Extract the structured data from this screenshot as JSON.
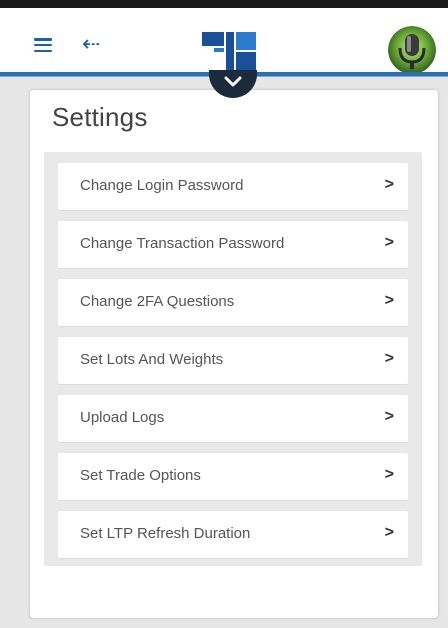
{
  "colors": {
    "accent": "#1f5fa8",
    "header_rule": "#2a6fb0",
    "badge": "#1c2b3c",
    "background": "#e6e6e6"
  },
  "header": {
    "menu_icon": "hamburger-menu-icon",
    "back_icon": "back-arrow-icon",
    "back_glyph": "⇠",
    "logo": "brand-logo",
    "avatar": "microphone-avatar",
    "expand_icon": "chevron-down-icon"
  },
  "settings": {
    "title": "Settings",
    "items": [
      {
        "label": "Change Login Password",
        "arrow": ">"
      },
      {
        "label": "Change Transaction Password",
        "arrow": ">"
      },
      {
        "label": "Change 2FA Questions",
        "arrow": ">"
      },
      {
        "label": "Set Lots And Weights",
        "arrow": ">"
      },
      {
        "label": "Upload Logs",
        "arrow": ">"
      },
      {
        "label": "Set Trade Options",
        "arrow": ">"
      },
      {
        "label": "Set LTP Refresh Duration",
        "arrow": ">"
      }
    ]
  }
}
